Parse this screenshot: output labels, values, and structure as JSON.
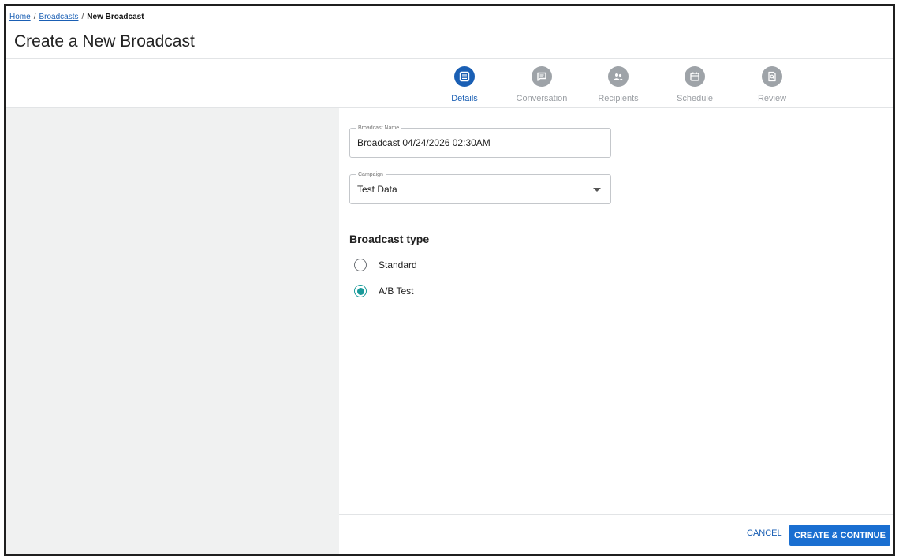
{
  "breadcrumb": {
    "home": "Home",
    "separator": "/",
    "broadcasts": "Broadcasts",
    "current": "New Broadcast"
  },
  "page": {
    "title": "Create a New Broadcast"
  },
  "stepper": {
    "steps": [
      {
        "label": "Details",
        "icon": "details-list-icon",
        "active": true
      },
      {
        "label": "Conversation",
        "icon": "chat-icon",
        "active": false
      },
      {
        "label": "Recipients",
        "icon": "people-icon",
        "active": false
      },
      {
        "label": "Schedule",
        "icon": "calendar-icon",
        "active": false
      },
      {
        "label": "Review",
        "icon": "review-doc-icon",
        "active": false
      }
    ]
  },
  "form": {
    "broadcast_name": {
      "legend": "Broadcast Name",
      "value": "Broadcast 04/24/2026 02:30AM"
    },
    "campaign": {
      "legend": "Campaign",
      "value": "Test Data"
    },
    "broadcast_type": {
      "title": "Broadcast type",
      "options": [
        {
          "label": "Standard",
          "selected": false
        },
        {
          "label": "A/B Test",
          "selected": true
        }
      ]
    }
  },
  "footer": {
    "cancel_label": "CANCEL",
    "primary_label": "CREATE & CONTINUE"
  },
  "colors": {
    "accent": "#1a5fb4",
    "primary_button": "#1a6fd1",
    "radio_checked": "#1a9a9a",
    "inactive_step": "#9ea3a8",
    "left_panel": "#f0f1f1"
  }
}
